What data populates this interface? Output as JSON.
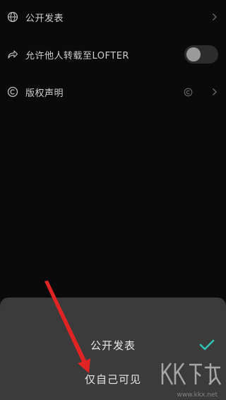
{
  "settings": {
    "rows": [
      {
        "label": "公开发表",
        "icon": "globe-icon",
        "trailing": "chevron-right-icon"
      },
      {
        "label": "允许他人转载至LOFTER",
        "icon": "share-forward-icon",
        "trailing": "toggle",
        "toggle_on": false
      },
      {
        "label": "版权声明",
        "icon": "copyright-icon",
        "trailing": "chevron-right-icon",
        "extra_icon": "copyright-small-icon"
      }
    ]
  },
  "sheet": {
    "options": [
      {
        "label": "公开发表",
        "selected": true
      },
      {
        "label": "仅自己可见",
        "selected": false
      }
    ],
    "accent_color": "#2ec4b6"
  },
  "watermark": {
    "text": "KK下载",
    "url": "www.kkx.net"
  }
}
